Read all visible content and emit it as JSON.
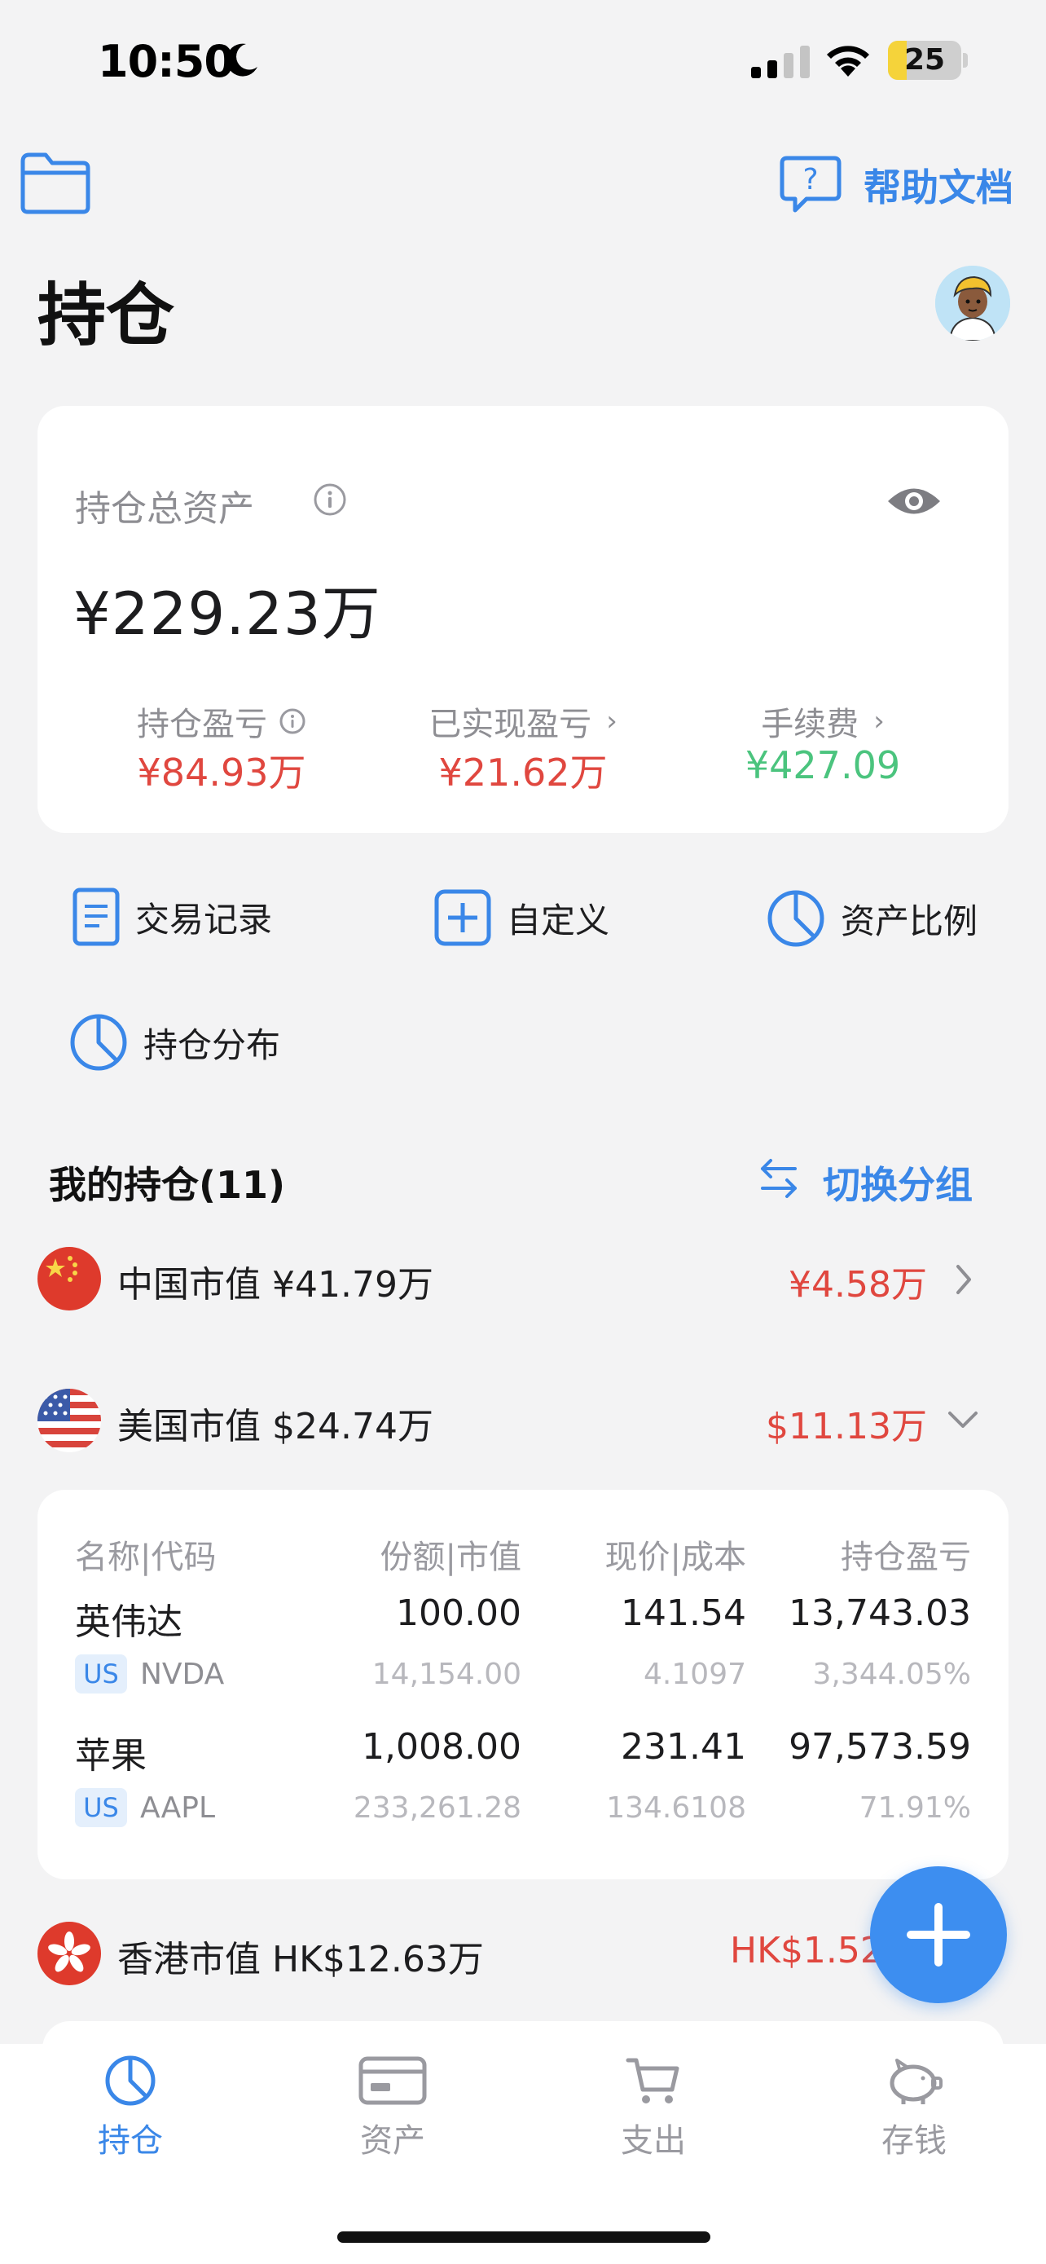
{
  "status": {
    "time": "10:50",
    "battery": "25",
    "battery_level": 0.25
  },
  "header": {
    "help_label": "帮助文档",
    "title": "持仓"
  },
  "summary": {
    "total_label": "持仓总资产",
    "total_value": "¥229.23万",
    "stats": [
      {
        "label": "持仓盈亏",
        "value": "¥84.93万"
      },
      {
        "label": "已实现盈亏",
        "value": "¥21.62万"
      },
      {
        "label": "手续费",
        "value": "¥427.09"
      }
    ]
  },
  "actions": [
    {
      "label": "交易记录",
      "icon": "document-icon"
    },
    {
      "label": "自定义",
      "icon": "plus-square-icon"
    },
    {
      "label": "资产比例",
      "icon": "pie-chart-icon"
    },
    {
      "label": "持仓分布",
      "icon": "pie-chart-icon"
    }
  ],
  "holdings_section": {
    "title": "我的持仓(11)",
    "switch_label": "切换分组"
  },
  "markets": [
    {
      "label": "中国市值 ¥41.79万",
      "pl": "¥4.58万",
      "flag": "cn-flag-icon"
    },
    {
      "label": "美国市值 $24.74万",
      "pl": "$11.13万",
      "flag": "us-flag-icon"
    },
    {
      "label": "香港市值 HK$12.63万",
      "pl": "HK$1.52",
      "flag": "hk-flag-icon"
    }
  ],
  "table": {
    "headers": [
      "名称|代码",
      "份额|市值",
      "现价|成本",
      "持仓盈亏"
    ],
    "rows": [
      {
        "name": "英伟达",
        "market": "US",
        "code": "NVDA",
        "shares": "100.00",
        "value": "14,154.00",
        "price": "141.54",
        "cost": "4.1097",
        "pl": "13,743.03",
        "pl_pct": "3,344.05%"
      },
      {
        "name": "苹果",
        "market": "US",
        "code": "AAPL",
        "shares": "1,008.00",
        "value": "233,261.28",
        "price": "231.41",
        "cost": "134.6108",
        "pl": "97,573.59",
        "pl_pct": "71.91%"
      }
    ]
  },
  "tabs": [
    {
      "label": "持仓",
      "icon": "pie-chart-icon",
      "active": true
    },
    {
      "label": "资产",
      "icon": "card-icon",
      "active": false
    },
    {
      "label": "支出",
      "icon": "cart-icon",
      "active": false
    },
    {
      "label": "存钱",
      "icon": "piggy-bank-icon",
      "active": false
    }
  ],
  "colors": {
    "accent": "#3a87e8",
    "loss_gain_red": "#e0473f",
    "fee_green": "#4bc47e"
  }
}
